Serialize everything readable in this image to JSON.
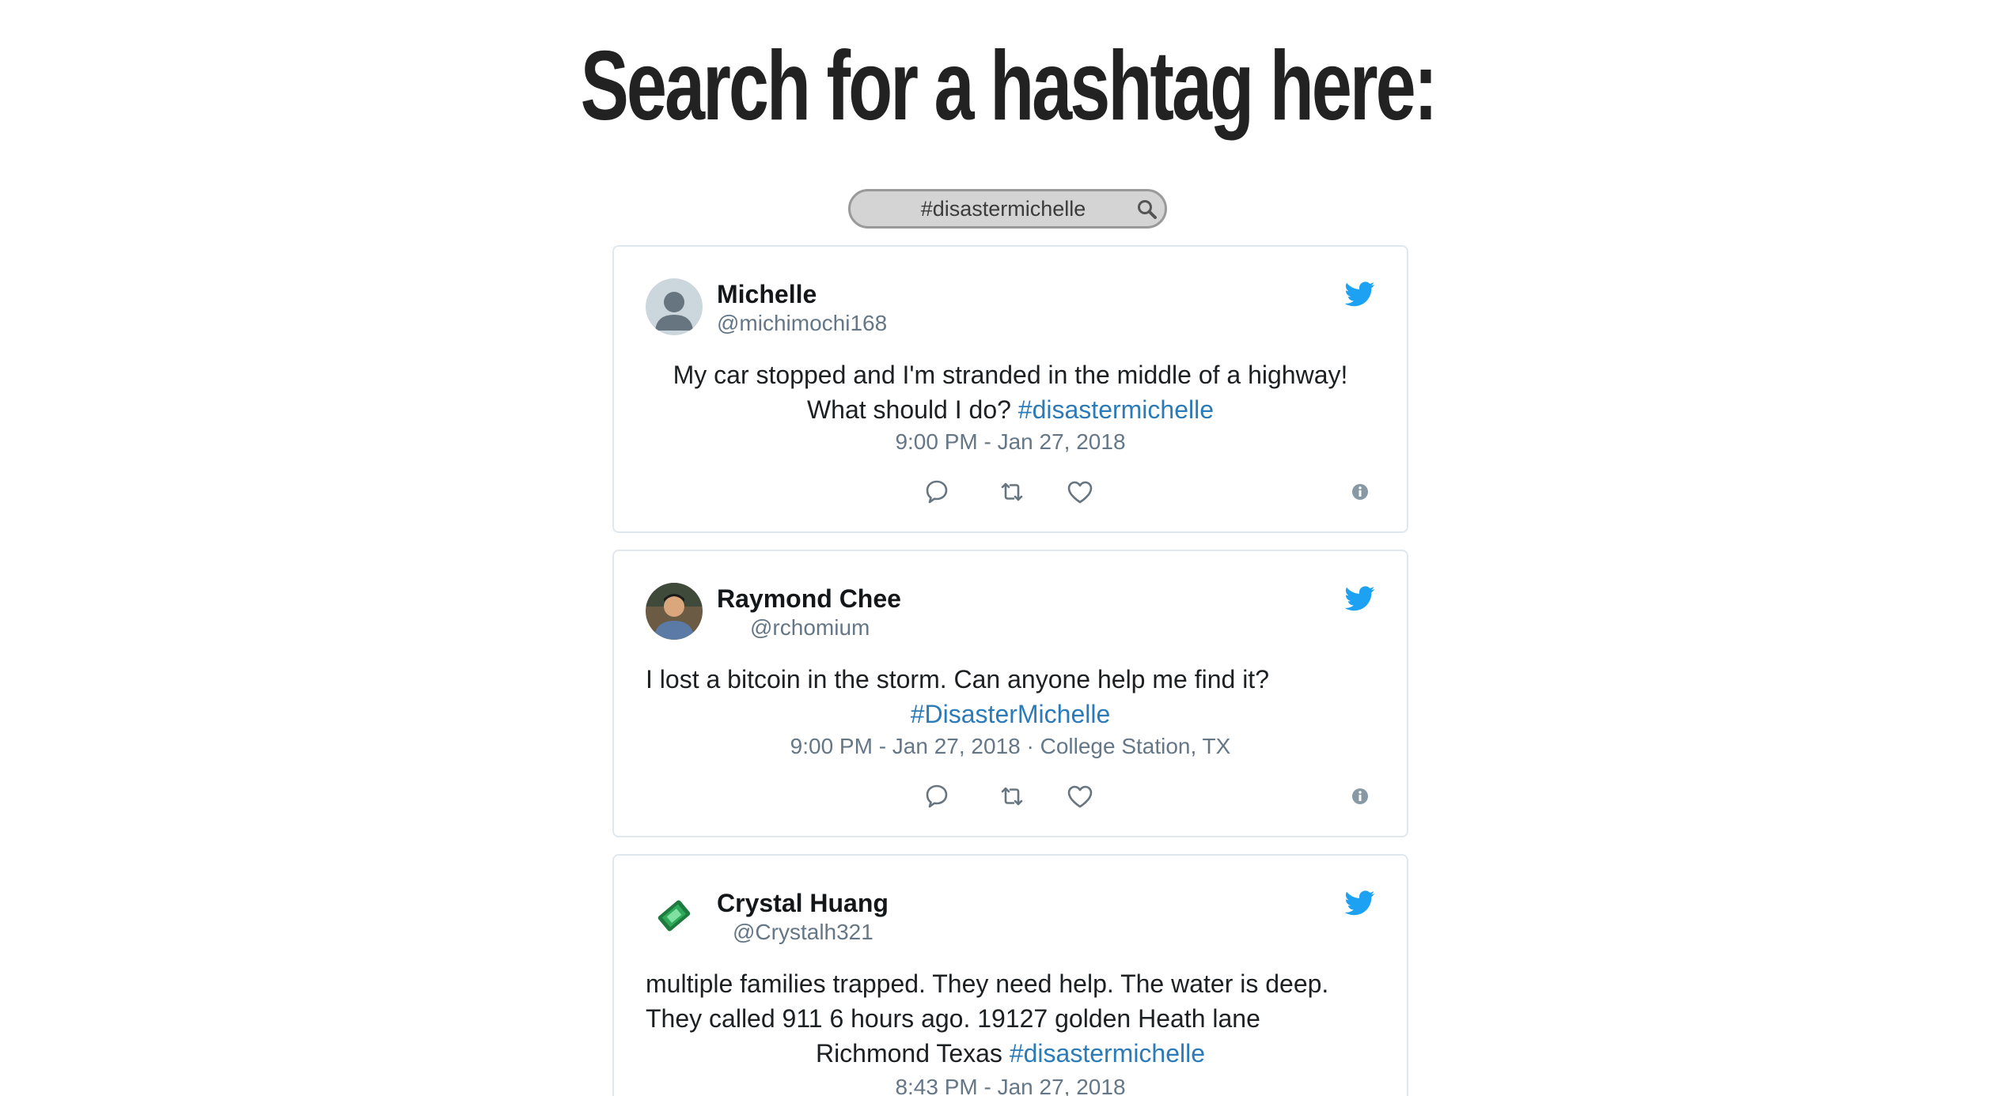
{
  "heading": "Search for a hashtag here:",
  "search": {
    "value": "#disastermichelle",
    "icon": "magnifier"
  },
  "colors": {
    "heading": "#222222",
    "hashtag": "#2b7bb9",
    "twitter_blue": "#1da1f2",
    "meta": "#657786",
    "card_border": "#e1e8ed"
  },
  "tweets": [
    {
      "name": "Michelle",
      "handle": "@michimochi168",
      "avatar": "default-avatar",
      "lines": [
        "My car stopped and I'm stranded in the middle of a highway!",
        "What should I do?"
      ],
      "hashtag": "#disastermichelle",
      "meta": "9:00 PM - Jan 27, 2018"
    },
    {
      "name": "Raymond Chee",
      "handle": "@rchomium",
      "avatar": "photo-avatar",
      "lines": [
        "I lost a bitcoin in the storm. Can anyone help me find it?"
      ],
      "hashtag": "#DisasterMichelle",
      "meta": "9:00 PM - Jan 27, 2018 · College Station, TX"
    },
    {
      "name": "Crystal Huang",
      "handle": "@Crystalh321",
      "avatar": "emerald-gem-avatar",
      "lines": [
        "multiple families trapped. They need help. The water is deep.",
        "They called 911 6 hours ago.  19127 golden Heath lane",
        "Richmond Texas"
      ],
      "hashtag": "#disastermichelle",
      "meta": "8:43 PM - Jan 27, 2018"
    }
  ],
  "icons": {
    "brand": "twitter-bird",
    "reply": "speech-bubble",
    "retweet": "retweet-arrows",
    "like": "heart",
    "info": "info-circle"
  }
}
